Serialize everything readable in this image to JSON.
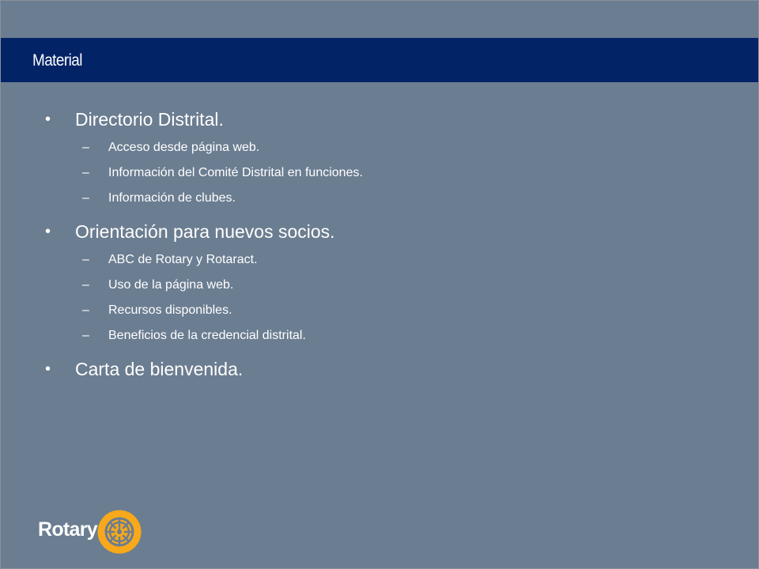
{
  "slide": {
    "title": "Material"
  },
  "content": {
    "bullets": [
      {
        "marker": "•",
        "label": "Directorio Distrital.",
        "subitems": [
          {
            "marker": "–",
            "label": "Acceso desde página web."
          },
          {
            "marker": "–",
            "label": "Información del Comité Distrital en funciones."
          },
          {
            "marker": "–",
            "label": "Información de clubes."
          }
        ]
      },
      {
        "marker": "•",
        "label": "Orientación para nuevos socios.",
        "subitems": [
          {
            "marker": "–",
            "label": "ABC de Rotary y Rotaract."
          },
          {
            "marker": "–",
            "label": "Uso de la página web."
          },
          {
            "marker": "–",
            "label": "Recursos disponibles."
          },
          {
            "marker": "–",
            "label": "Beneficios de la credencial distrital."
          }
        ]
      },
      {
        "marker": "•",
        "label": "Carta de bienvenida."
      }
    ]
  },
  "footer": {
    "logo_text": "Rotary",
    "logo_icon": "rotary-wheel-icon"
  },
  "colors": {
    "background": "#6b7d91",
    "title_bar": "#022366",
    "text": "#ffffff",
    "logo_gold": "#f7a81b"
  }
}
